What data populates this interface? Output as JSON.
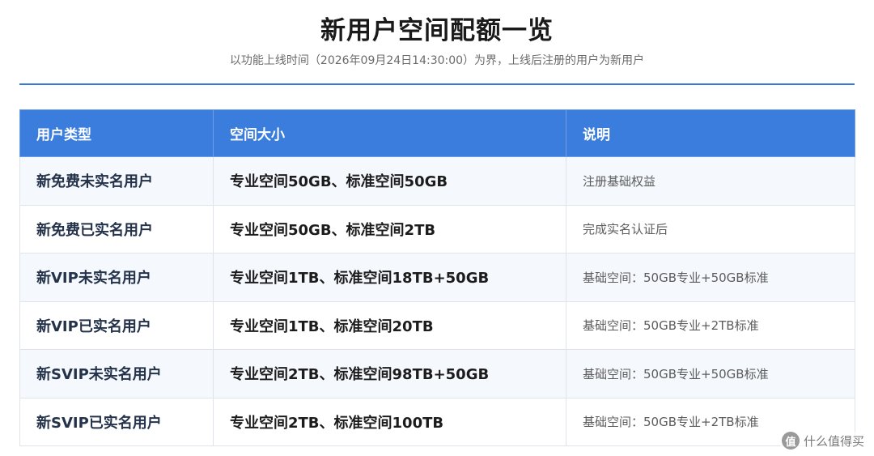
{
  "header": {
    "title": "新用户空间配额一览",
    "subtitle": "以功能上线时间（2026年09月24日14:30:00）为界，上线后注册的用户为新用户"
  },
  "table": {
    "columns": [
      "用户类型",
      "空间大小",
      "说明"
    ],
    "rows": [
      {
        "type": "新免费未实名用户",
        "size": "专业空间50GB、标准空间50GB",
        "note": "注册基础权益"
      },
      {
        "type": "新免费已实名用户",
        "size": "专业空间50GB、标准空间2TB",
        "note": "完成实名认证后"
      },
      {
        "type": "新VIP未实名用户",
        "size": "专业空间1TB、标准空间18TB+50GB",
        "note": "基础空间：50GB专业+50GB标准"
      },
      {
        "type": "新VIP已实名用户",
        "size": "专业空间1TB、标准空间20TB",
        "note": "基础空间：50GB专业+2TB标准"
      },
      {
        "type": "新SVIP未实名用户",
        "size": "专业空间2TB、标准空间98TB+50GB",
        "note": "基础空间：50GB专业+50GB标准"
      },
      {
        "type": "新SVIP已实名用户",
        "size": "专业空间2TB、标准空间100TB",
        "note": "基础空间：50GB专业+2TB标准"
      }
    ]
  },
  "watermark": {
    "icon_char": "值",
    "text": "什么值得买"
  },
  "colors": {
    "accent": "#3b7ddd",
    "divider": "#3a78d8",
    "row_alt": "#f5f8fd"
  }
}
